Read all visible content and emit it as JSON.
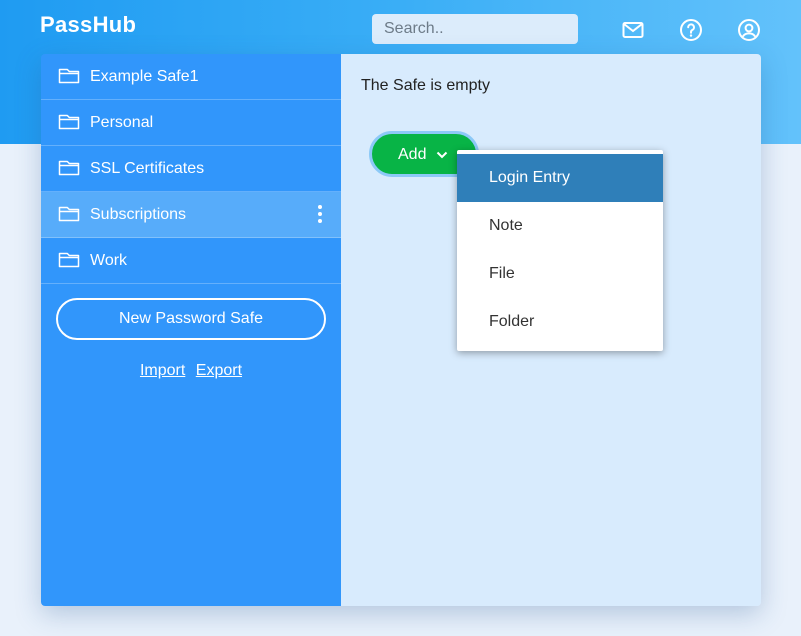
{
  "header": {
    "logo": "PassHub",
    "search_placeholder": "Search..",
    "icons": [
      "mail-icon",
      "help-icon",
      "account-icon"
    ]
  },
  "sidebar": {
    "safes": [
      {
        "label": "Example Safe1"
      },
      {
        "label": "Personal"
      },
      {
        "label": "SSL Certificates"
      },
      {
        "label": "Subscriptions",
        "active": true
      },
      {
        "label": "Work"
      }
    ],
    "new_safe_label": "New Password Safe",
    "import_label": "Import",
    "export_label": "Export"
  },
  "main": {
    "empty_text": "The Safe is empty",
    "add_label": "Add",
    "menu_items": [
      "Login Entry",
      "Note",
      "File",
      "Folder"
    ]
  },
  "colors": {
    "sidebar": "#3196fb",
    "active_safe": "#57acfa",
    "main_bg": "#d8ebfd",
    "add_button": "#08b446",
    "menu_selected": "#2f7fb9"
  }
}
